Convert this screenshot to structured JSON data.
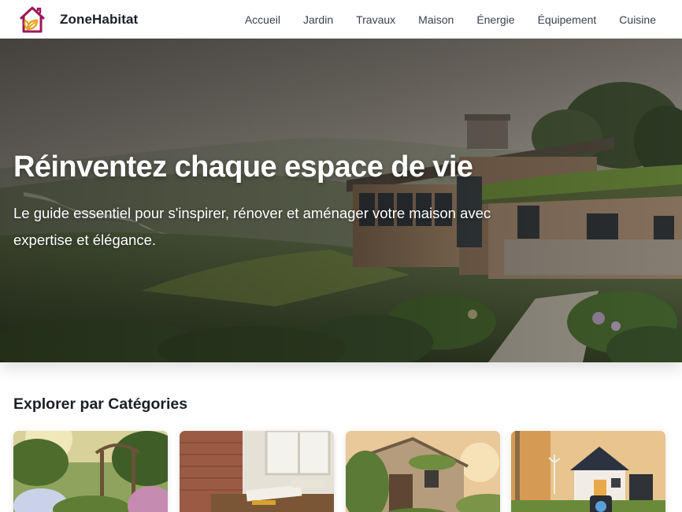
{
  "brand": {
    "name": "ZoneHabitat",
    "logo_icon": "house-leaf-logo",
    "colors": {
      "house": "#9c1658",
      "leaf": "#e8a21c"
    }
  },
  "nav": {
    "items": [
      {
        "label": "Accueil"
      },
      {
        "label": "Jardin"
      },
      {
        "label": "Travaux"
      },
      {
        "label": "Maison"
      },
      {
        "label": "Énergie"
      },
      {
        "label": "Équipement"
      },
      {
        "label": "Cuisine"
      }
    ]
  },
  "hero": {
    "title": "Réinventez chaque espace de vie",
    "subtitle": "Le guide essentiel pour s'inspirer, rénover et aménager votre maison avec expertise et élégance."
  },
  "categories": {
    "title": "Explorer par Catégories",
    "cards": [
      {
        "image": "garden-photo"
      },
      {
        "image": "renovation-photo"
      },
      {
        "image": "stone-house-photo"
      },
      {
        "image": "solar-house-photo"
      }
    ]
  }
}
